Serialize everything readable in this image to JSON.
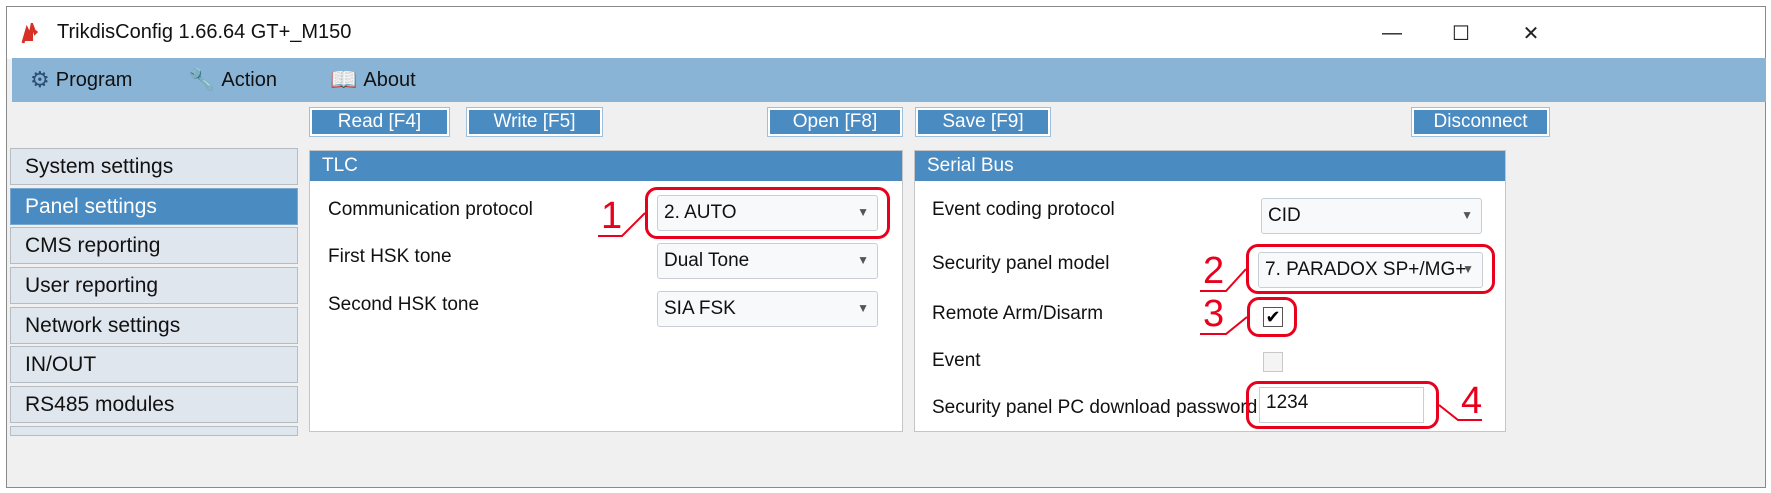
{
  "window": {
    "title": "TrikdisConfig 1.66.64   GT+_M150",
    "controls": {
      "minimize": "—",
      "maximize": "☐",
      "close": "✕"
    }
  },
  "menu": [
    {
      "label": "Program",
      "icon": "gear-icon"
    },
    {
      "label": "Action",
      "icon": "wrench-icon"
    },
    {
      "label": "About",
      "icon": "book-icon"
    }
  ],
  "toolbar": {
    "read": "Read [F4]",
    "write": "Write [F5]",
    "open": "Open [F8]",
    "save": "Save [F9]",
    "disconnect": "Disconnect"
  },
  "sidebar": {
    "items": [
      {
        "label": "System settings",
        "active": false
      },
      {
        "label": "Panel settings",
        "active": true
      },
      {
        "label": "CMS reporting",
        "active": false
      },
      {
        "label": "User reporting",
        "active": false
      },
      {
        "label": "Network settings",
        "active": false
      },
      {
        "label": "IN/OUT",
        "active": false
      },
      {
        "label": "RS485 modules",
        "active": false
      }
    ]
  },
  "tlc": {
    "title": "TLC",
    "communication_protocol": {
      "label": "Communication protocol",
      "value": "2. AUTO"
    },
    "first_hsk_tone": {
      "label": "First HSK tone",
      "value": "Dual Tone"
    },
    "second_hsk_tone": {
      "label": "Second HSK tone",
      "value": "SIA FSK"
    }
  },
  "serial_bus": {
    "title": "Serial Bus",
    "event_coding_protocol": {
      "label": "Event coding protocol",
      "value": "CID"
    },
    "security_panel_model": {
      "label": "Security panel model",
      "value": "7. PARADOX SP+/MG+"
    },
    "remote_arm_disarm": {
      "label": "Remote Arm/Disarm",
      "checked": true
    },
    "event": {
      "label": "Event",
      "checked": false,
      "enabled": false
    },
    "pc_download_password": {
      "label": "Security panel PC download password",
      "value": "1234"
    }
  },
  "callouts": [
    "1",
    "2",
    "3",
    "4"
  ],
  "colors": {
    "accent": "#4a8bc2",
    "menubar": "#8ab4d6",
    "highlight": "#e8001c"
  }
}
